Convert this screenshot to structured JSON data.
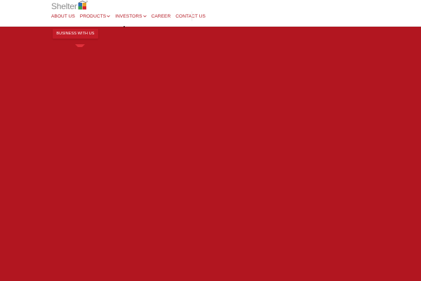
{
  "brand": {
    "name": "Shelter",
    "mark_icon": "shelter-logo-mark"
  },
  "nav": {
    "items": [
      {
        "label": "ABOUT US",
        "has_dropdown": false
      },
      {
        "label": "PRODUCTS",
        "has_dropdown": true
      },
      {
        "label": "INVESTORS",
        "has_dropdown": true
      },
      {
        "label": "CAREER",
        "has_dropdown": false
      },
      {
        "label": "CONTACT US",
        "has_dropdown": false
      }
    ]
  },
  "dropdown": {
    "item_label": "BUSINESS WITH US"
  },
  "colors": {
    "brand_red": "#b21620",
    "nav_text": "#b21620",
    "logo_text": "#8a8a8a",
    "header_bg": "#ffffff"
  }
}
